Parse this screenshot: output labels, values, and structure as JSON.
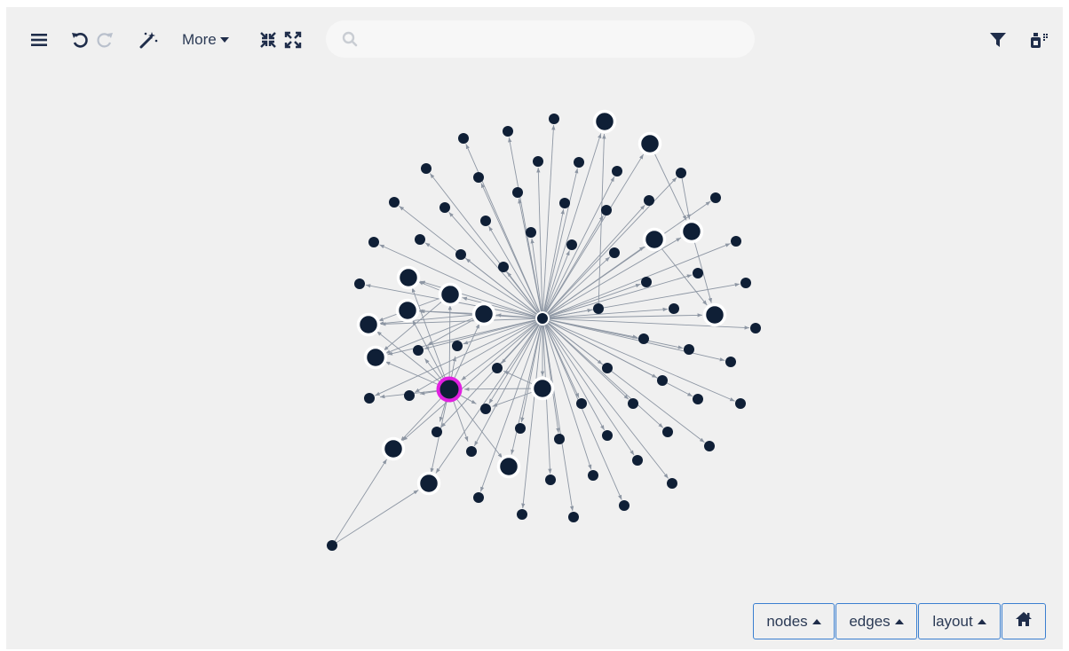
{
  "toolbar": {
    "menu_icon": "hamburger-menu-icon",
    "undo_icon": "undo-icon",
    "redo_icon": "redo-icon",
    "magic_icon": "magic-wand-icon",
    "more_label": "More",
    "collapse_icon": "compress-icon",
    "expand_icon": "expand-icon",
    "filter_icon": "filter-icon",
    "settings_icon": "layer-settings-icon"
  },
  "search": {
    "placeholder": "",
    "value": "",
    "icon": "search-icon"
  },
  "panel_buttons": {
    "nodes_label": "nodes",
    "edges_label": "edges",
    "layout_label": "layout",
    "home_icon": "home-icon"
  },
  "colors": {
    "node": "#0f1f36",
    "node_ring": "#ffffff",
    "selected_ring": "#e020e0",
    "edge": "#8d96a3",
    "background": "#f0f0f0",
    "button_border": "#3a7fd0"
  },
  "graph": {
    "center_node": {
      "id": "hub",
      "selected": false
    },
    "selected_node_id": "sel"
  }
}
